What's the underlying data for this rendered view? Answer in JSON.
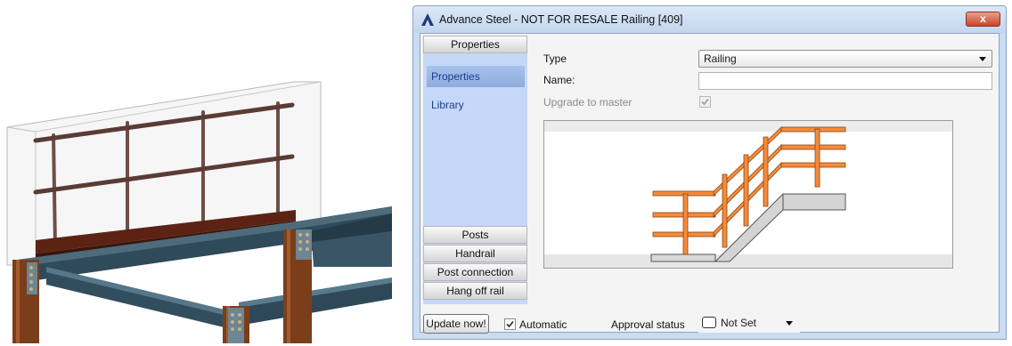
{
  "window": {
    "title": "Advance Steel - NOT FOR RESALE  Railing [409]",
    "close_symbol": "x",
    "app_icon": "advance-steel-logo-icon",
    "close_icon": "close-icon"
  },
  "nav": {
    "header": "Properties",
    "items": [
      {
        "label": "Properties",
        "selected": true
      },
      {
        "label": "Library",
        "selected": false
      }
    ],
    "categories": [
      "Posts",
      "Handrail",
      "Post connection",
      "Hang off rail"
    ]
  },
  "form": {
    "type_label": "Type",
    "type_value": "Railing",
    "name_label": "Name:",
    "name_value": "",
    "upgrade_label": "Upgrade to master",
    "upgrade_checked": true,
    "upgrade_disabled": true
  },
  "footer": {
    "update_button": "Update now!",
    "automatic_label": "Automatic",
    "automatic_checked": true,
    "approval_label": "Approval status",
    "approval_value": "Not Set"
  },
  "colors": {
    "railing_orange": "#f58b3a",
    "rail_dark_red": "#5c2314",
    "steel_beam": "#2f4a59",
    "nav_bg": "#c6d8f7",
    "close_red": "#c9442a"
  }
}
